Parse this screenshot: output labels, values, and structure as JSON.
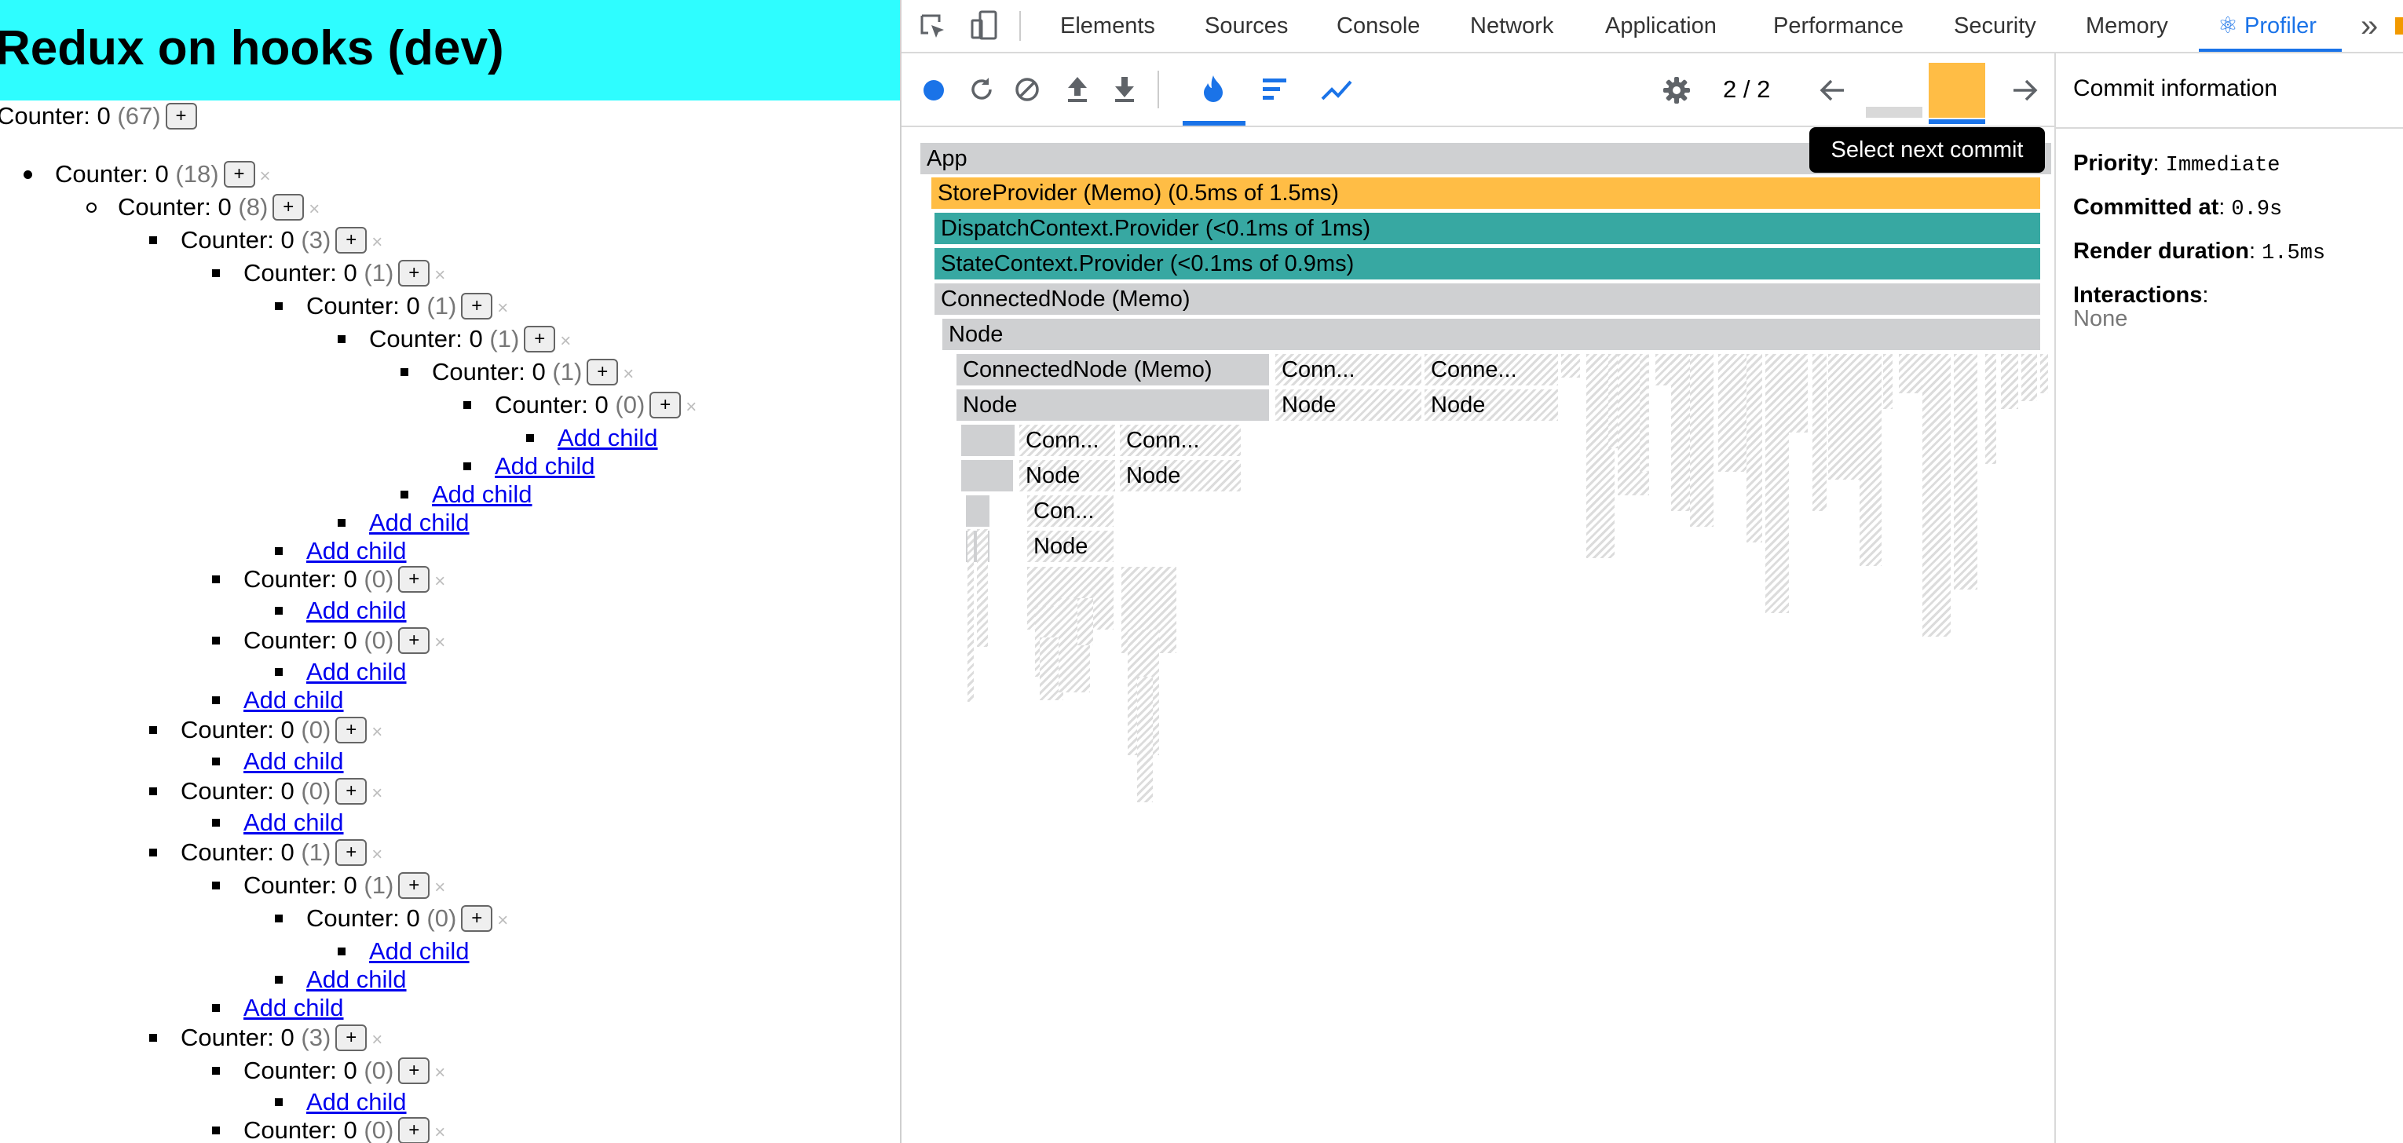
{
  "app": {
    "title": "Redux on hooks (dev)",
    "plus_label": "+",
    "close_label": "×",
    "add_child_label": "Add child",
    "counters": [
      {
        "label": "Counter: 0",
        "count": "(67)"
      },
      {
        "label": "Counter: 0",
        "count": "(18)"
      },
      {
        "label": "Counter: 0",
        "count": "(8)"
      },
      {
        "label": "Counter: 0",
        "count": "(3)"
      },
      {
        "label": "Counter: 0",
        "count": "(1)"
      },
      {
        "label": "Counter: 0",
        "count": "(1)"
      },
      {
        "label": "Counter: 0",
        "count": "(1)"
      },
      {
        "label": "Counter: 0",
        "count": "(1)"
      },
      {
        "label": "Counter: 0",
        "count": "(0)"
      },
      {
        "label": "Counter: 0",
        "count": "(0)"
      },
      {
        "label": "Counter: 0",
        "count": "(0)"
      },
      {
        "label": "Counter: 0",
        "count": "(0)"
      },
      {
        "label": "Counter: 0",
        "count": "(0)"
      },
      {
        "label": "Counter: 0",
        "count": "(1)"
      },
      {
        "label": "Counter: 0",
        "count": "(1)"
      },
      {
        "label": "Counter: 0",
        "count": "(0)"
      },
      {
        "label": "Counter: 0",
        "count": "(3)"
      },
      {
        "label": "Counter: 0",
        "count": "(0)"
      },
      {
        "label": "Counter: 0",
        "count": "(0)"
      }
    ]
  },
  "devtools": {
    "tabs": [
      "Elements",
      "Sources",
      "Console",
      "Network",
      "Application",
      "Performance",
      "Security",
      "Memory",
      "⚛ Profiler"
    ],
    "more_tabs_label": "»",
    "commit_counter": "2 / 2",
    "tooltip": "Select next commit",
    "flame": {
      "app": "App",
      "store_provider": "StoreProvider (Memo) (0.5ms of 1.5ms)",
      "dispatch_provider": "DispatchContext.Provider (<0.1ms of 1ms)",
      "state_provider": "StateContext.Provider (<0.1ms of 0.9ms)",
      "connected_node": "ConnectedNode (Memo)",
      "node": "Node",
      "conn_short_1": "Conn...",
      "conn_short_2": "Conne...",
      "con_short": "Con...",
      "colors": {
        "highlight": "#ffbd45",
        "teal": "#37a8a2",
        "gray": "#cfd0d2"
      }
    },
    "sidebar": {
      "title": "Commit information",
      "priority_label": "Priority",
      "priority_value": "Immediate",
      "committed_label": "Committed at",
      "committed_value": "0.9s",
      "duration_label": "Render duration",
      "duration_value": "1.5ms",
      "interactions_label": "Interactions",
      "interactions_value": "None"
    }
  }
}
